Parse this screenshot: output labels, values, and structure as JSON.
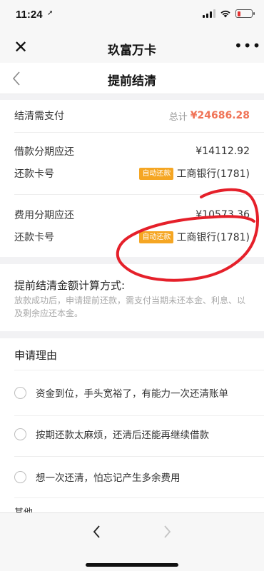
{
  "status_bar": {
    "time": "11:24",
    "location_glyph": "➚",
    "battery_color": "#e33333"
  },
  "wechat_nav": {
    "close_glyph": "✕",
    "title": "玖富万卡",
    "more_glyph": "•••"
  },
  "page": {
    "title": "提前结清"
  },
  "summary": {
    "label": "结清需支付",
    "total_prefix": "总计",
    "total_amount": "¥24686.28",
    "accent_color": "#f07356"
  },
  "loan_installment": {
    "label": "借款分期应还",
    "amount": "¥14112.92",
    "card_label": "还款卡号",
    "tag": "自动还款",
    "bank": "工商银行(1781)"
  },
  "fee_installment": {
    "label": "费用分期应还",
    "amount": "¥10573.36",
    "card_label": "还款卡号",
    "tag": "自动还款",
    "bank": "工商银行(1781)"
  },
  "calculation": {
    "title": "提前结清金额计算方式:",
    "description": "放款成功后，申请提前还款，需支付当期未还本金、利息、以及剩余应还本金。"
  },
  "reasons": {
    "title": "申请理由",
    "options": [
      "资金到位，手头宽裕了，有能力一次还清账单",
      "按期还款太麻烦，还清后还能再继续借款",
      "想一次还清，怕忘记产生多余费用",
      "其他"
    ]
  },
  "bottom_nav": {
    "back_icon": "chevron-left",
    "forward_icon": "chevron-right"
  }
}
